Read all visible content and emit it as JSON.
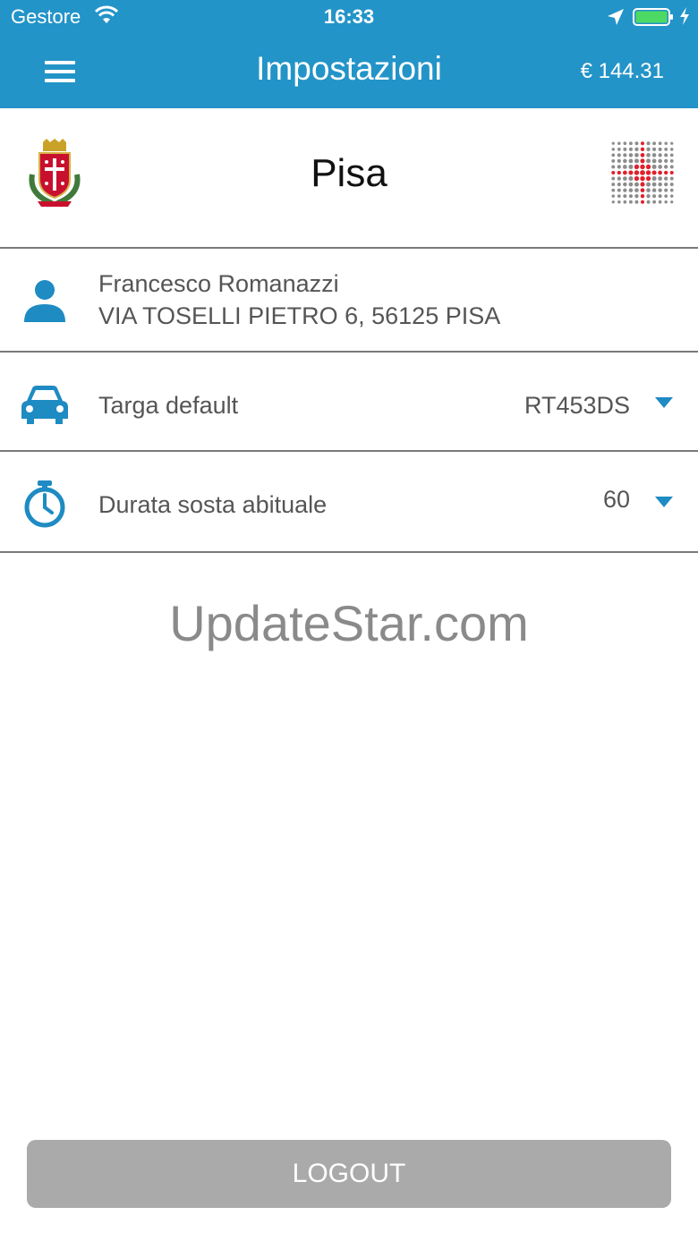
{
  "status_bar": {
    "carrier": "Gestore",
    "time": "16:33",
    "battery_color": "#4cd964"
  },
  "header": {
    "title": "Impostazioni",
    "balance": "€ 144.31",
    "background_color": "#2394c8",
    "menu_icon": "hamburger-menu-icon"
  },
  "city": {
    "name": "Pisa",
    "crest_icon": "city-crest-icon",
    "logo_icon": "dotted-cross-logo-icon"
  },
  "user": {
    "name": "Francesco Romanazzi",
    "address": "VIA TOSELLI PIETRO 6, 56125 PISA",
    "icon": "person-icon"
  },
  "plate": {
    "label": "Targa default",
    "value": "RT453DS",
    "icon": "car-icon"
  },
  "duration": {
    "label": "Durata sosta abituale",
    "value": "60",
    "icon": "stopwatch-icon"
  },
  "watermark": "UpdateStar.com",
  "logout_label": "LOGOUT",
  "accent_color": "#1e8bc3"
}
